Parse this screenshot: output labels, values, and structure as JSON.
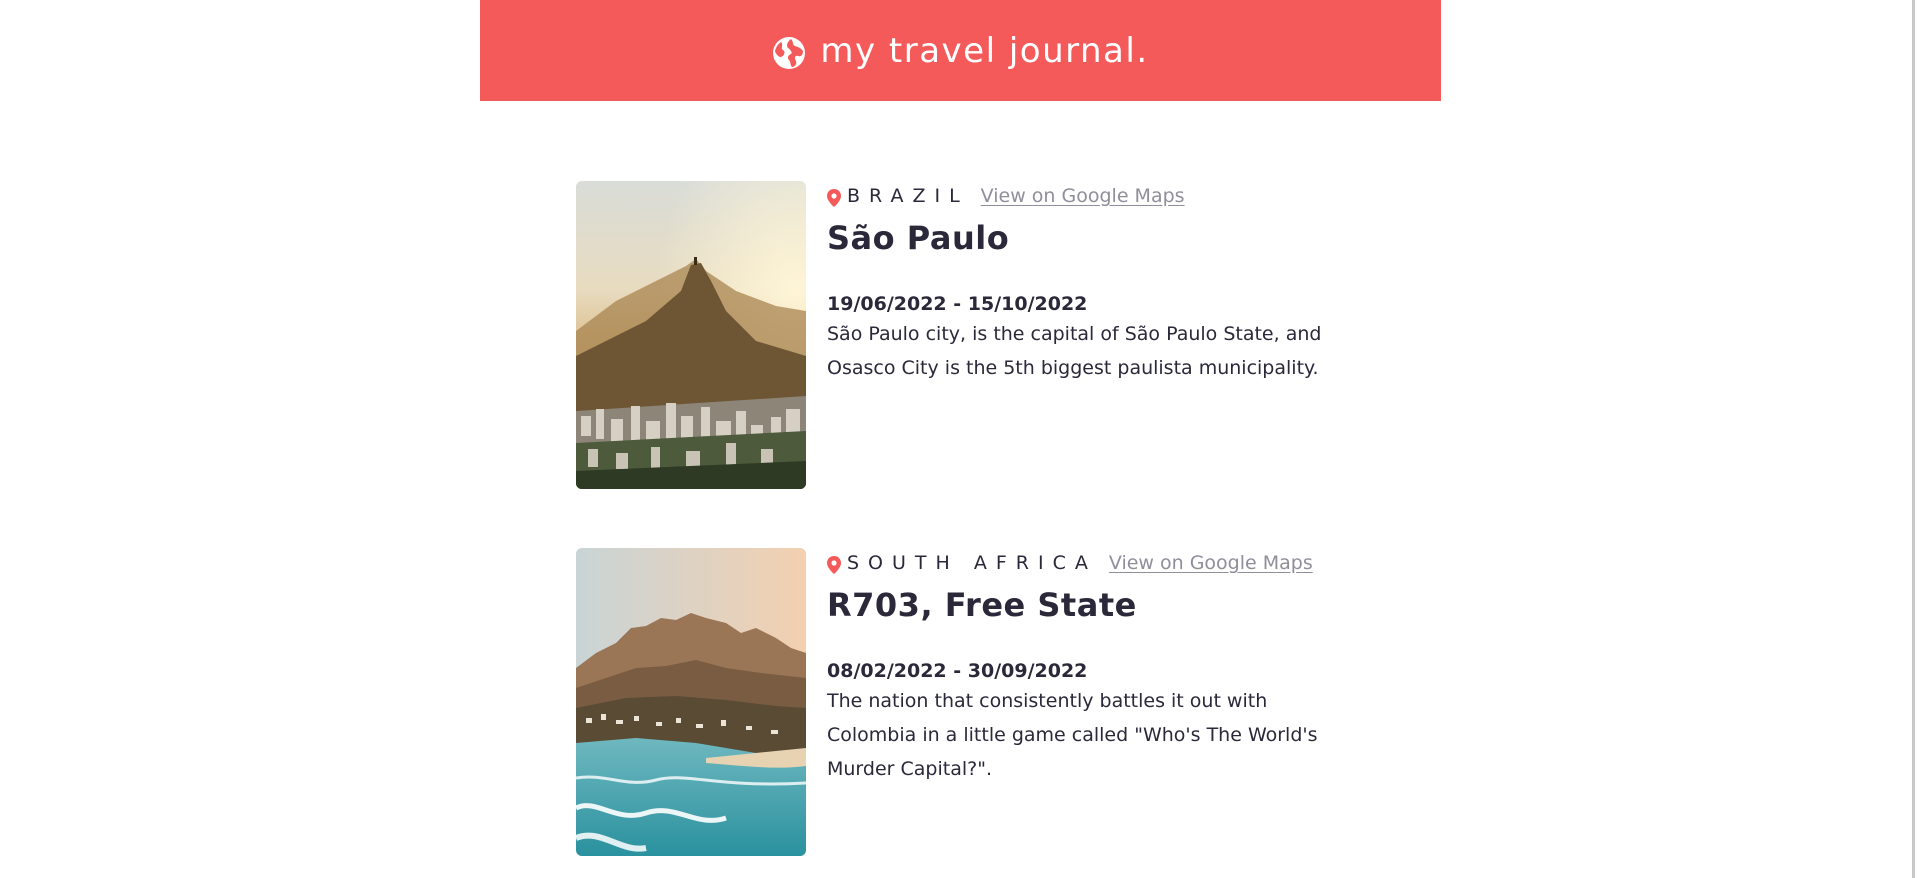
{
  "header": {
    "title": "my travel journal.",
    "icon": "globe-icon",
    "background": "#F55A5A"
  },
  "entries": [
    {
      "country": "BRAZIL",
      "maps_link": "View on Google Maps",
      "title": "São Paulo",
      "dates": "19/06/2022 - 15/10/2022",
      "description": "São Paulo city, is the capital of São Paulo State, and Osasco City is the 5th biggest paulista municipality."
    },
    {
      "country": "SOUTH AFRICA",
      "maps_link": "View on Google Maps",
      "title": "R703, Free State",
      "dates": "08/02/2022 - 30/09/2022",
      "description": "The nation that consistently battles it out with Colombia in a little game called \"Who's The World's Murder Capital?\"."
    }
  ],
  "colors": {
    "accent": "#F55A5A",
    "text": "#2B283A",
    "link": "#918E9B"
  }
}
